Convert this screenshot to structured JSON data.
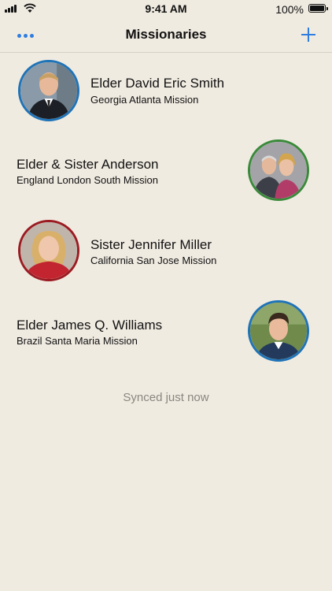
{
  "status_bar": {
    "time": "9:41 AM",
    "battery": "100%"
  },
  "nav": {
    "title": "Missionaries",
    "more_icon": "ellipsis-icon",
    "add_icon": "plus-icon"
  },
  "colors": {
    "accent": "#2f7de1",
    "blue_ring": "#1f73b7",
    "green_ring": "#3a8a3a",
    "red_ring": "#9b1b22"
  },
  "missionaries": [
    {
      "name": "Elder David Eric Smith",
      "mission": "Georgia Atlanta Mission",
      "ring": "#1f73b7",
      "photo_side": "left"
    },
    {
      "name": "Elder & Sister Anderson",
      "mission": "England London South Mission",
      "ring": "#3a8a3a",
      "photo_side": "right"
    },
    {
      "name": "Sister Jennifer Miller",
      "mission": "California San Jose Mission",
      "ring": "#9b1b22",
      "photo_side": "left"
    },
    {
      "name": "Elder James Q. Williams",
      "mission": "Brazil Santa Maria Mission",
      "ring": "#1f73b7",
      "photo_side": "right"
    }
  ],
  "sync_status": "Synced just now"
}
